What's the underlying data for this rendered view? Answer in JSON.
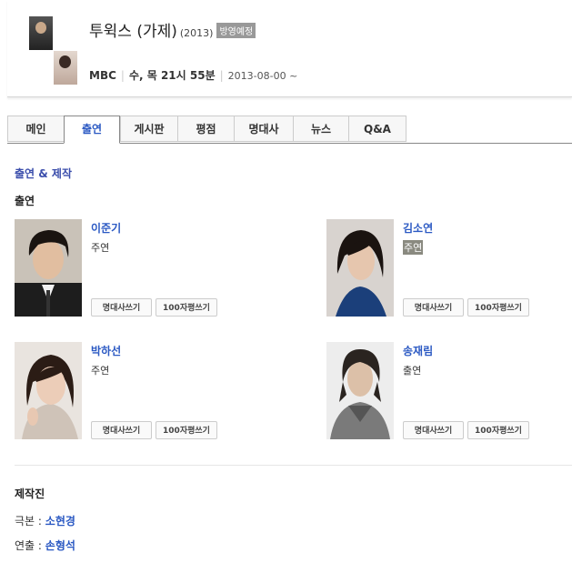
{
  "show": {
    "title": "투윅스 (가제)",
    "year": "(2013)",
    "badge": "방영예정",
    "network": "MBC",
    "schedule": "수, 목 21시 55분",
    "date": "2013-08-00 ~"
  },
  "tabs": [
    "메인",
    "출연",
    "게시판",
    "평점",
    "명대사",
    "뉴스",
    "Q&A"
  ],
  "active_tab": "출연",
  "section_title": "출연 & 제작",
  "cast_title": "출연",
  "cast": [
    {
      "name": "이준기",
      "role": "주연",
      "btn_quote": "명대사쓰기",
      "btn_review": "100자평쓰기"
    },
    {
      "name": "김소연",
      "role": "주연",
      "btn_quote": "명대사쓰기",
      "btn_review": "100자평쓰기"
    },
    {
      "name": "박하선",
      "role": "주연",
      "btn_quote": "명대사쓰기",
      "btn_review": "100자평쓰기"
    },
    {
      "name": "송재림",
      "role": "출연",
      "btn_quote": "명대사쓰기",
      "btn_review": "100자평쓰기"
    }
  ],
  "staff_title": "제작진",
  "staff": [
    {
      "label": "극본 :",
      "name": "소현경"
    },
    {
      "label": "연출 :",
      "name": "손형석"
    }
  ]
}
